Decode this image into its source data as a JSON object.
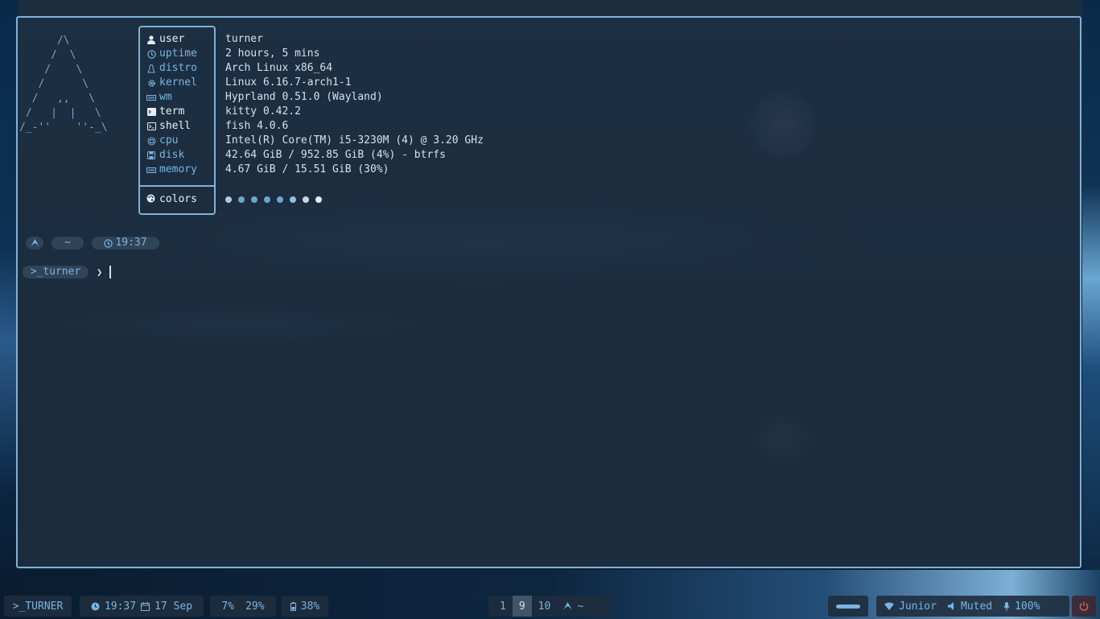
{
  "ascii_logo": "      /\\\n     /  \\\n    /    \\\n   /      \\\n  /   ,,   \\\n /   |  |   \\\n/_-''    ''-_\\",
  "fetch": {
    "rows": [
      {
        "icon": "user-icon",
        "key": "user",
        "value": "turner"
      },
      {
        "icon": "clock-icon",
        "key": "uptime",
        "value": "2 hours, 5 mins"
      },
      {
        "icon": "linux-icon",
        "key": "distro",
        "value": "Arch Linux x86_64"
      },
      {
        "icon": "gear-icon",
        "key": "kernel",
        "value": "Linux 6.16.7-arch1-1"
      },
      {
        "icon": "memory-icon",
        "key": "wm",
        "value": "Hyprland 0.51.0 (Wayland)"
      },
      {
        "icon": "terminal-icon",
        "key": "term",
        "value": "kitty 0.42.2"
      },
      {
        "icon": "shell-icon",
        "key": "shell",
        "value": "fish 4.0.6"
      },
      {
        "icon": "cpu-icon",
        "key": "cpu",
        "value": "Intel(R) Core(TM) i5-3230M (4) @ 3.20 GHz"
      },
      {
        "icon": "disk-icon",
        "key": "disk",
        "value": "42.64 GiB / 952.85 GiB (4%) - btrfs"
      },
      {
        "icon": "memory-icon",
        "key": "memory",
        "value": "4.67 GiB / 15.51 GiB (30%)"
      }
    ],
    "colors_label": "colors",
    "colors_dots": [
      "#b8c8d8",
      "#6fa6d0",
      "#6fa6d0",
      "#6fa6d0",
      "#6fa6d0",
      "#8fc0e4",
      "#c6d8e8",
      "#e4eef6"
    ]
  },
  "prompt": {
    "segment_arch_icon": "arch-icon",
    "segment_dir": "~",
    "segment_time": "19:37",
    "user_label": ">_turner",
    "chevron": "❯"
  },
  "statusbar": {
    "user": ">_TURNER",
    "time": "19:37",
    "date": "17 Sep",
    "cpu": "7%",
    "mem": "29%",
    "battery": "38%",
    "workspaces": [
      "1",
      "9",
      "10"
    ],
    "active_workspace": "9",
    "window_dir": "~",
    "wifi": "Junior",
    "volume": "Muted",
    "mic": "100%"
  },
  "colors": {
    "accent": "#7ab4e0",
    "border": "#7fb2d6",
    "text": "#d6e0ea",
    "power": "#e05a5a"
  }
}
